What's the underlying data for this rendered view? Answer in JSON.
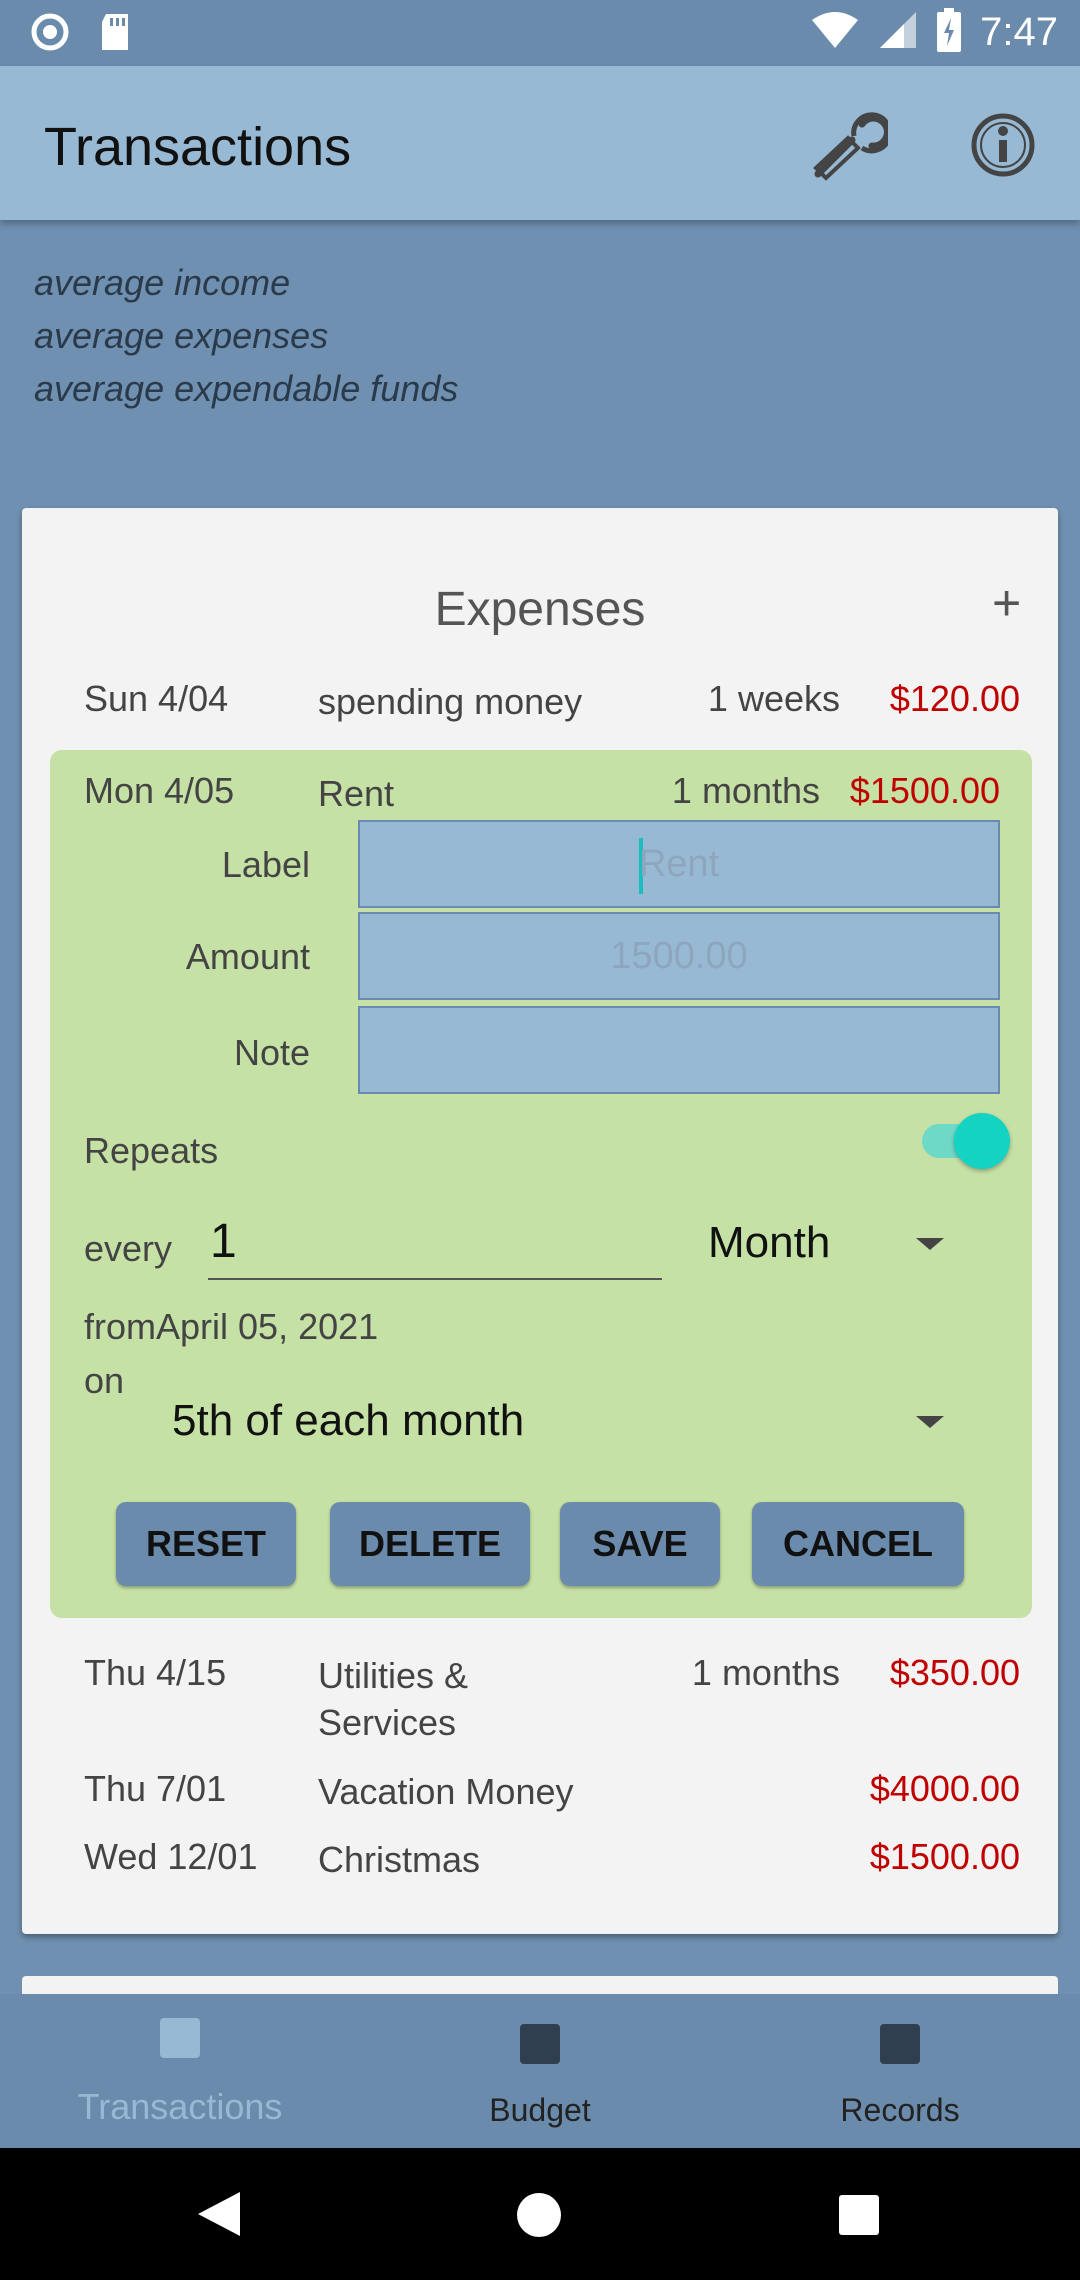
{
  "status_bar": {
    "time": "7:47"
  },
  "app_bar": {
    "title": "Transactions"
  },
  "summary": {
    "lines": [
      "average income",
      "average expenses",
      "average expendable funds"
    ]
  },
  "expenses": {
    "title": "Expenses",
    "add_label": "+",
    "rows": [
      {
        "date": "Sun 4/04",
        "label": "spending money",
        "freq": "1 weeks",
        "amount": "$120.00"
      }
    ],
    "editing": {
      "date": "Mon 4/05",
      "label": "Rent",
      "freq": "1 months",
      "amount": "$1500.00",
      "form": {
        "label_caption": "Label",
        "label_placeholder": "Rent",
        "amount_caption": "Amount",
        "amount_placeholder": "1500.00",
        "note_caption": "Note",
        "note_value": "",
        "repeats_caption": "Repeats",
        "repeats_on": true,
        "every_caption": "every",
        "every_value": "1",
        "period": "Month",
        "from_text": "fromApril 05, 2021",
        "on_caption": "on",
        "on_value": "5th of each month",
        "buttons": {
          "reset": "RESET",
          "delete": "DELETE",
          "save": "SAVE",
          "cancel": "CANCEL"
        }
      }
    },
    "rows_after": [
      {
        "date": "Thu 4/15",
        "label": "Utilities & Services",
        "freq": "1 months",
        "amount": "$350.00"
      },
      {
        "date": "Thu 7/01",
        "label": "Vacation Money",
        "freq": "",
        "amount": "$4000.00"
      },
      {
        "date": "Wed 12/01",
        "label": "Christmas",
        "freq": "",
        "amount": "$1500.00"
      }
    ]
  },
  "bottom_nav": {
    "items": [
      {
        "label": "Transactions",
        "active": true
      },
      {
        "label": "Budget",
        "active": false
      },
      {
        "label": "Records",
        "active": false
      }
    ]
  },
  "colors": {
    "amount": "#c00000",
    "accent": "#14d3c3",
    "edit_bg": "#c6e1a5",
    "app_bar": "#98b9d4"
  }
}
